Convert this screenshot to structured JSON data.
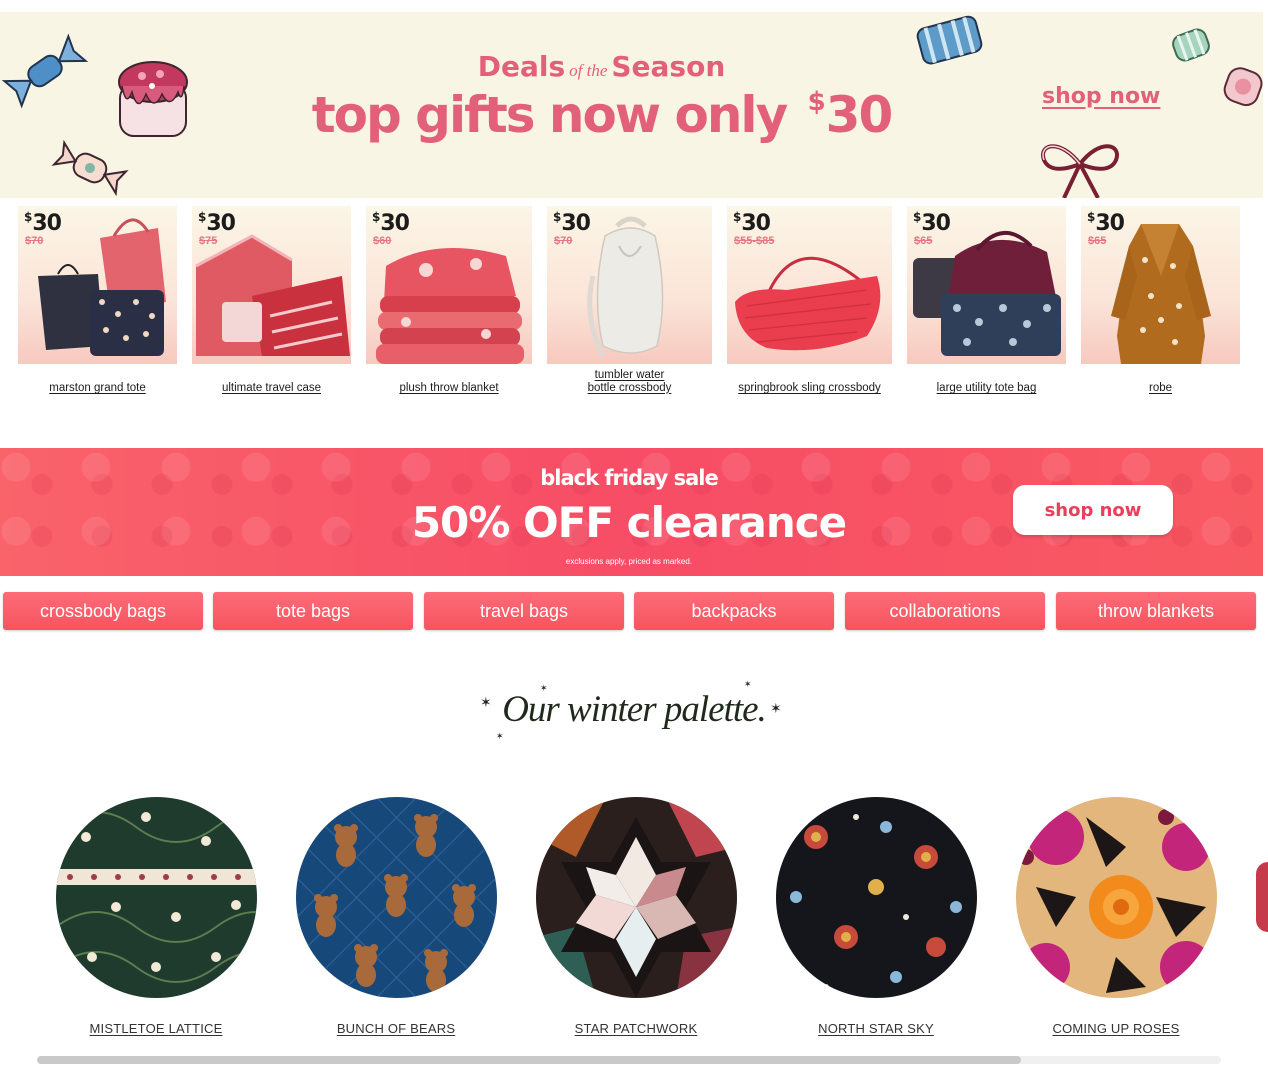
{
  "hero": {
    "deals_left": "Deals",
    "deals_of_the": "of the",
    "deals_right": "Season",
    "headline": "top gifts now only ",
    "headline_currency": "$",
    "headline_amount": "30",
    "cta": "shop now",
    "accent_color": "#e2607a",
    "background": "#f8f5e4"
  },
  "products": [
    {
      "currency": "$",
      "price": "30",
      "was": "$70",
      "name": "marston grand tote"
    },
    {
      "currency": "$",
      "price": "30",
      "was": "$75",
      "name": "ultimate travel case"
    },
    {
      "currency": "$",
      "price": "30",
      "was": "$60",
      "name": "plush throw blanket"
    },
    {
      "currency": "$",
      "price": "30",
      "was": "$70",
      "name": "tumbler water bottle crossbody",
      "name_line1": "tumbler water",
      "name_line2": "bottle crossbody"
    },
    {
      "currency": "$",
      "price": "30",
      "was": "$55-$85",
      "name": "springbrook sling crossbody"
    },
    {
      "currency": "$",
      "price": "30",
      "was": "$65",
      "name": "large utility tote bag"
    },
    {
      "currency": "$",
      "price": "30",
      "was": "$65",
      "name": "robe"
    }
  ],
  "black_friday": {
    "kicker": "black friday sale",
    "headline": "50% OFF clearance",
    "fine_print": "exclusions apply, priced as marked.",
    "cta": "shop now",
    "background": "#f85a62"
  },
  "categories": [
    "crossbody bags",
    "tote bags",
    "travel bags",
    "backpacks",
    "collaborations",
    "throw blankets"
  ],
  "palette": {
    "title": "Our winter palette.",
    "items": [
      "MISTLETOE LATTICE",
      "BUNCH OF BEARS",
      "STAR PATCHWORK",
      "NORTH STAR SKY",
      "COMING UP ROSES"
    ]
  },
  "icons": {
    "stars": "star-icon",
    "candy": "candy-icon",
    "cake": "cake-icon",
    "bow": "bow-icon"
  }
}
